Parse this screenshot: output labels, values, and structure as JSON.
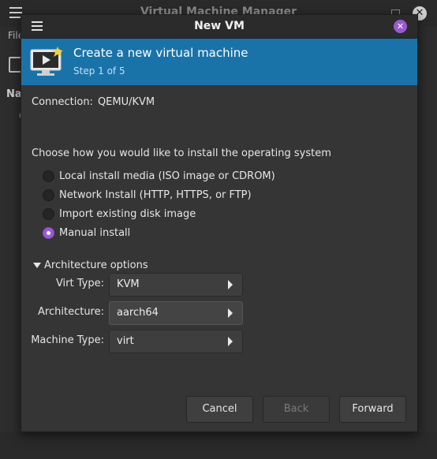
{
  "main_window": {
    "title": "Virtual Machine Manager",
    "menu_label": "File",
    "column_header": "Na",
    "row_partial": "Q"
  },
  "dialog": {
    "title": "New VM",
    "banner": {
      "title": "Create a new virtual machine",
      "step": "Step 1 of 5"
    },
    "connection": {
      "label": "Connection:",
      "value": "QEMU/KVM"
    },
    "install_prompt": "Choose how you would like to install the operating system",
    "install_options": [
      {
        "label": "Local install media (ISO image or CDROM)",
        "selected": false
      },
      {
        "label": "Network Install (HTTP, HTTPS, or FTP)",
        "selected": false
      },
      {
        "label": "Import existing disk image",
        "selected": false
      },
      {
        "label": "Manual install",
        "selected": true
      }
    ],
    "architecture": {
      "toggle_label": "Architecture options",
      "expanded": true,
      "virt_type": {
        "label": "Virt Type:",
        "value": "KVM"
      },
      "arch": {
        "label": "Architecture:",
        "value": "aarch64"
      },
      "machine_type": {
        "label": "Machine Type:",
        "value": "virt"
      }
    },
    "buttons": {
      "cancel": "Cancel",
      "back": "Back",
      "forward": "Forward"
    }
  },
  "colors": {
    "accent": "#9b59d0",
    "banner": "#1a73a8",
    "dialog_bg": "#353535"
  }
}
